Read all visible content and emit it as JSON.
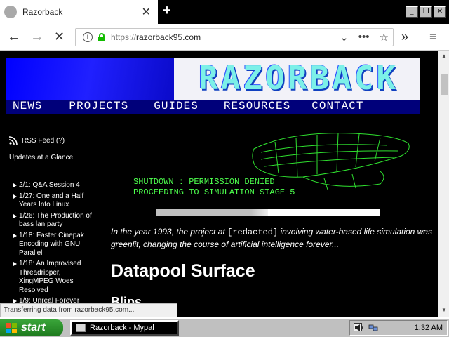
{
  "browser": {
    "tab_title": "Razorback",
    "tab_close": "✕",
    "new_tab": "+",
    "url_proto": "https://",
    "url_host": "razorback95.com",
    "status": "Transferring data from razorback95.com..."
  },
  "site": {
    "logo": "RAZORBACK",
    "menu": [
      "NEWS",
      "PROJECTS",
      "GUIDES",
      "RESOURCES",
      "CONTACT"
    ],
    "rss": "RSS Feed (?)",
    "glance": "Updates at a Glance",
    "updates": [
      "2/1: Q&A Session 4",
      "1/27: One and a Half Years Into Linux",
      "1/26: The Production of bass lan party",
      "1/18: Faster Cinepak Encoding with GNU Parallel",
      "1/18: An Improvised Threadripper, XingMPEG Woes Resolved",
      "1/9: Unreal Forever"
    ],
    "status_line1": "SHUTDOWN : PERMISSION DENIED",
    "status_line2": "PROCEEDING TO SIMULATION STAGE 5",
    "progress": 0.5,
    "intro_a": "In the year 1993, the project at ",
    "intro_redacted": "[redacted]",
    "intro_b": " involving water-based life simulation was greenlit, changing the course of artificial intelligence forever...",
    "heading": "Datapool Surface",
    "subheading": "Blips"
  },
  "taskbar": {
    "start": "start",
    "task": "Razorback - Mypal",
    "clock": "1:32 AM"
  }
}
